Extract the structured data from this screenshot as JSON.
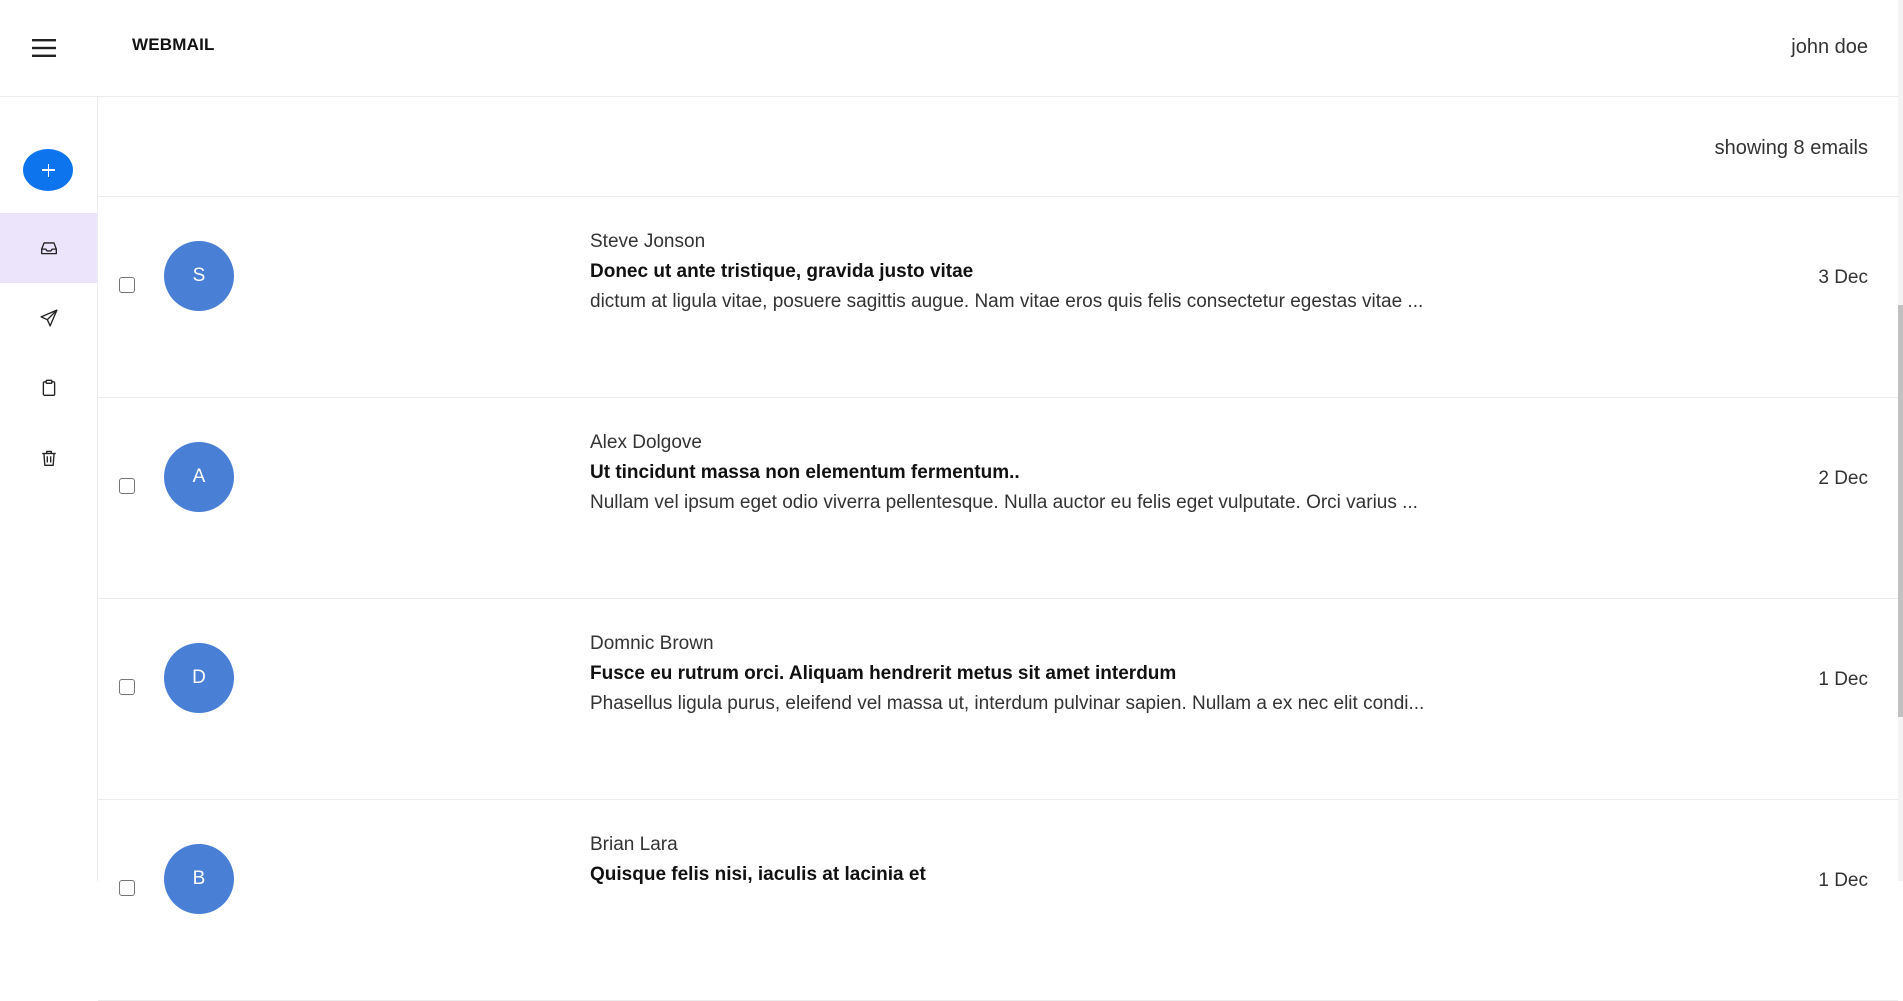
{
  "header": {
    "title": "WEBMAIL",
    "user": "john doe"
  },
  "sidebar": {
    "compose_icon": "plus-icon",
    "items": [
      {
        "icon": "inbox-icon",
        "active": true
      },
      {
        "icon": "send-icon",
        "active": false
      },
      {
        "icon": "clipboard-icon",
        "active": false
      },
      {
        "icon": "trash-icon",
        "active": false
      }
    ]
  },
  "main": {
    "count_label": "showing 8 emails",
    "emails": [
      {
        "initial": "S",
        "sender": "Steve Jonson",
        "subject": "Donec ut ante tristique, gravida justo vitae",
        "preview": "dictum at ligula vitae, posuere sagittis augue. Nam vitae eros quis felis consectetur egestas vitae ...",
        "date": "3 Dec"
      },
      {
        "initial": "A",
        "sender": "Alex Dolgove",
        "subject": "Ut tincidunt massa non elementum fermentum..",
        "preview": "Nullam vel ipsum eget odio viverra pellentesque. Nulla auctor eu felis eget vulputate. Orci varius ...",
        "date": "2 Dec"
      },
      {
        "initial": "D",
        "sender": "Domnic Brown",
        "subject": "Fusce eu rutrum orci. Aliquam hendrerit metus sit amet interdum",
        "preview": "Phasellus ligula purus, eleifend vel massa ut, interdum pulvinar sapien. Nullam a ex nec elit condi...",
        "date": "1 Dec"
      },
      {
        "initial": "B",
        "sender": "Brian Lara",
        "subject": "Quisque felis nisi, iaculis at lacinia et",
        "preview": "",
        "date": "1 Dec"
      }
    ]
  },
  "colors": {
    "accent": "#0d74ee",
    "avatar": "#4a7fd6",
    "active_nav": "#ece4fb"
  }
}
